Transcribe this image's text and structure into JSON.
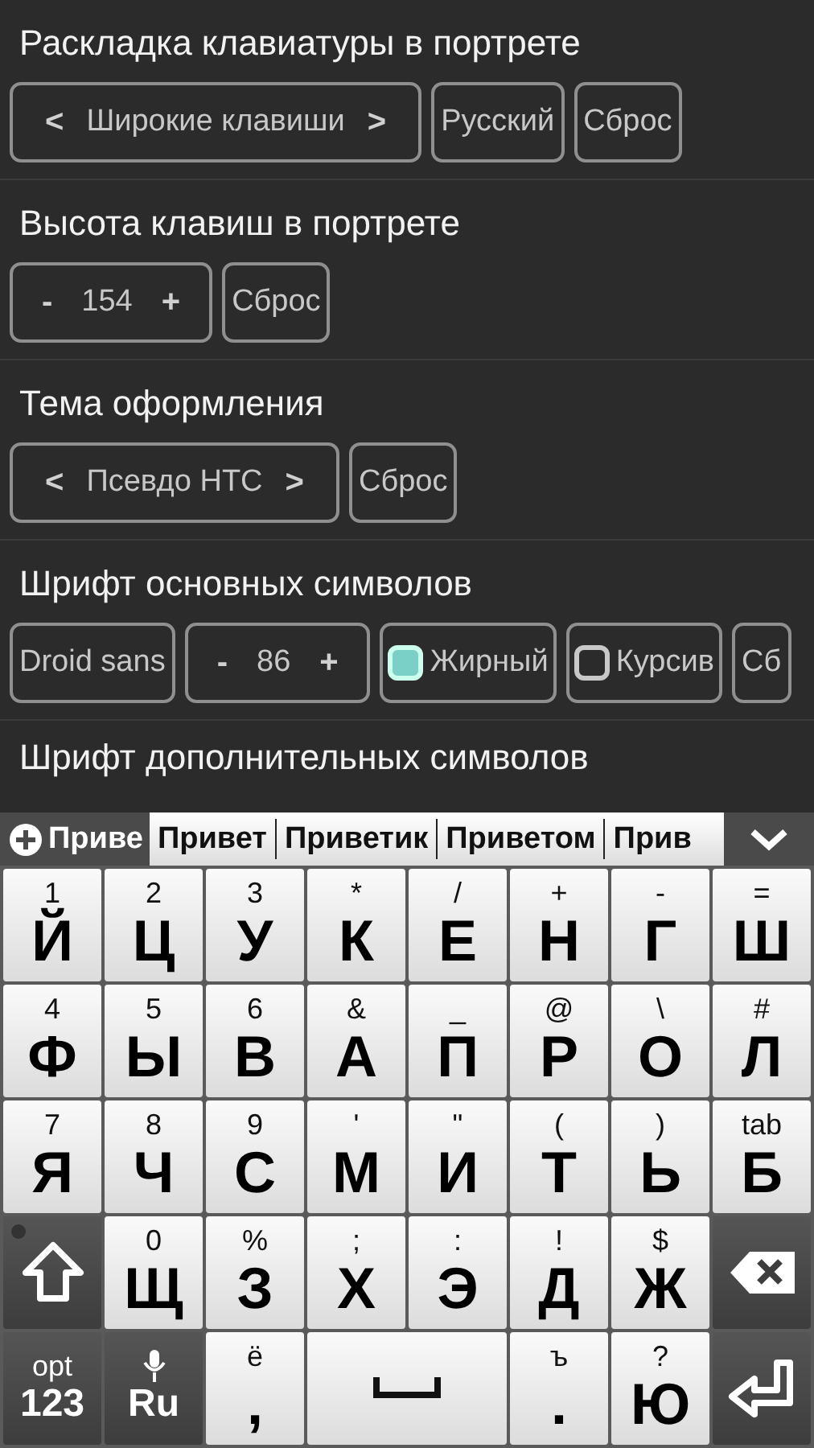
{
  "settings": [
    {
      "title": "Раскладка клавиатуры в портрете",
      "controls": [
        {
          "kind": "selector",
          "prev": "<",
          "value": "Широкие клавиши",
          "next": ">"
        },
        {
          "kind": "button",
          "label": "Русский"
        },
        {
          "kind": "button",
          "label": "Сброс"
        }
      ]
    },
    {
      "title": "Высота клавиш в портрете",
      "controls": [
        {
          "kind": "stepper",
          "minus": "-",
          "value": "154",
          "plus": "+"
        },
        {
          "kind": "button",
          "label": "Сброс"
        }
      ]
    },
    {
      "title": "Тема оформления",
      "controls": [
        {
          "kind": "selector",
          "prev": "<",
          "value": "Псевдо HTC",
          "next": ">"
        },
        {
          "kind": "button",
          "label": "Сброс"
        }
      ]
    },
    {
      "title": "Шрифт основных символов",
      "controls": [
        {
          "kind": "button",
          "label": "Droid sans"
        },
        {
          "kind": "stepper",
          "minus": "-",
          "value": "86",
          "plus": "+"
        },
        {
          "kind": "checkbox",
          "label": "Жирный",
          "checked": true
        },
        {
          "kind": "checkbox",
          "label": "Курсив",
          "checked": false
        },
        {
          "kind": "button",
          "label": "Сб"
        }
      ]
    },
    {
      "title": "Шрифт дополнительных символов"
    }
  ],
  "suggestions": {
    "typed": "Приве",
    "words": [
      "Привет",
      "Приветик",
      "Приветом",
      "Прив"
    ]
  },
  "keyboard": [
    [
      {
        "kind": "letter",
        "hint": "1",
        "label": "Й"
      },
      {
        "kind": "letter",
        "hint": "2",
        "label": "Ц"
      },
      {
        "kind": "letter",
        "hint": "3",
        "label": "У"
      },
      {
        "kind": "letter",
        "hint": "*",
        "label": "К"
      },
      {
        "kind": "letter",
        "hint": "/",
        "label": "Е"
      },
      {
        "kind": "letter",
        "hint": "+",
        "label": "Н"
      },
      {
        "kind": "letter",
        "hint": "-",
        "label": "Г"
      },
      {
        "kind": "letter",
        "hint": "=",
        "label": "Ш"
      }
    ],
    [
      {
        "kind": "letter",
        "hint": "4",
        "label": "Ф"
      },
      {
        "kind": "letter",
        "hint": "5",
        "label": "Ы"
      },
      {
        "kind": "letter",
        "hint": "6",
        "label": "В"
      },
      {
        "kind": "letter",
        "hint": "&",
        "label": "А"
      },
      {
        "kind": "letter",
        "hint": "_",
        "label": "П"
      },
      {
        "kind": "letter",
        "hint": "@",
        "label": "Р"
      },
      {
        "kind": "letter",
        "hint": "\\",
        "label": "О"
      },
      {
        "kind": "letter",
        "hint": "#",
        "label": "Л"
      }
    ],
    [
      {
        "kind": "letter",
        "hint": "7",
        "label": "Я"
      },
      {
        "kind": "letter",
        "hint": "8",
        "label": "Ч"
      },
      {
        "kind": "letter",
        "hint": "9",
        "label": "С"
      },
      {
        "kind": "letter",
        "hint": "'",
        "label": "М"
      },
      {
        "kind": "letter",
        "hint": "\"",
        "label": "И"
      },
      {
        "kind": "letter",
        "hint": "(",
        "label": "Т"
      },
      {
        "kind": "letter",
        "hint": ")",
        "label": "Ь"
      },
      {
        "kind": "letter",
        "hint": "tab",
        "label": "Б"
      }
    ],
    [
      {
        "kind": "shift"
      },
      {
        "kind": "letter",
        "hint": "0",
        "label": "Щ"
      },
      {
        "kind": "letter",
        "hint": "%",
        "label": "З"
      },
      {
        "kind": "letter",
        "hint": ";",
        "label": "Х"
      },
      {
        "kind": "letter",
        "hint": ":",
        "label": "Э"
      },
      {
        "kind": "letter",
        "hint": "!",
        "label": "Д"
      },
      {
        "kind": "letter",
        "hint": "$",
        "label": "Ж"
      },
      {
        "kind": "backspace"
      }
    ],
    [
      {
        "kind": "mode",
        "hint": "opt",
        "label": "123"
      },
      {
        "kind": "lang",
        "label": "Ru"
      },
      {
        "kind": "letter",
        "hint": "ё",
        "label": ","
      },
      {
        "kind": "space"
      },
      {
        "kind": "letter",
        "hint": "ъ",
        "label": "."
      },
      {
        "kind": "letter",
        "hint": "?",
        "label": "Ю"
      },
      {
        "kind": "enter"
      }
    ]
  ]
}
